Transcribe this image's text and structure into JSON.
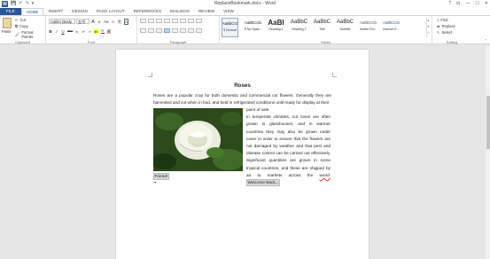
{
  "titlebar": {
    "title": "ReplaceBookmark.docx - Word",
    "word_icon_label": "W",
    "qat": [
      "💾",
      "↶",
      "↷",
      "▾"
    ],
    "controls": [
      "?",
      "⊟",
      "—",
      "☐",
      "✕"
    ]
  },
  "tabs": {
    "file": "FILE",
    "items": [
      "HOME",
      "INSERT",
      "DESIGN",
      "PAGE LAYOUT",
      "REFERENCES",
      "MAILINGS",
      "REVIEW",
      "VIEW"
    ],
    "active": "HOME"
  },
  "clipboard": {
    "paste": "Paste",
    "cut": "Cut",
    "copy": "Copy",
    "format_painter": "Format Painter",
    "label": "Clipboard"
  },
  "font": {
    "name": "Calibri (Body",
    "size": "五号",
    "grow": "A",
    "shrink": "A",
    "case": "Aa",
    "clear": "A",
    "pinyin": "文",
    "border": "A",
    "bold": "B",
    "italic": "I",
    "underline": "U",
    "strike": "abc",
    "sub": "x₂",
    "sup": "x²",
    "effects": "A",
    "highlight": "ab",
    "color": "A",
    "shade": "A",
    "label": "Font"
  },
  "paragraph": {
    "label": "Paragraph"
  },
  "styles": {
    "items": [
      {
        "preview": "AaBbCcDd",
        "name": "¶ Normal"
      },
      {
        "preview": "AaBbCcDd",
        "name": "¶ No Spac..."
      },
      {
        "preview": "AaBl",
        "name": "Heading 1"
      },
      {
        "preview": "AaBbC",
        "name": "Heading 2"
      },
      {
        "preview": "AaBbC",
        "name": "Title"
      },
      {
        "preview": "AaBbC",
        "name": "Subtitle"
      },
      {
        "preview": "AaBbCcDd",
        "name": "Subtle Em..."
      },
      {
        "preview": "AaBbCcDd",
        "name": "Intense E..."
      }
    ],
    "label": "Styles"
  },
  "editing": {
    "find": "Find",
    "replace": "Replace",
    "select": "Select",
    "label": "Editing"
  },
  "document": {
    "heading": "Roses",
    "intro": "Roses are a popular crop for both domestic and commercial cut flowers. Generally they are harvested and cut when in bud, and held in refrigerated conditions until ready for display at their",
    "wrap_text_1": "point of sale.",
    "wrap_text_2": "In temperate climates, cut roses are often grown in glasshouses, and in warmer countries they may also be grown under cover in order to ensure that the flowers are not damaged by weather and that pest and disease control can be carried out effectively. Significant quantities are grown in some tropical countries, and these are shipped by air to markets across the",
    "wrap_text_3": "world.",
    "bookmark_welcome": "Welcome Back...",
    "bookmark_friend": "Friend!"
  },
  "colors": {
    "accent": "#2b579a",
    "highlight_yellow": "#ffff00",
    "font_red": "#e00000"
  }
}
